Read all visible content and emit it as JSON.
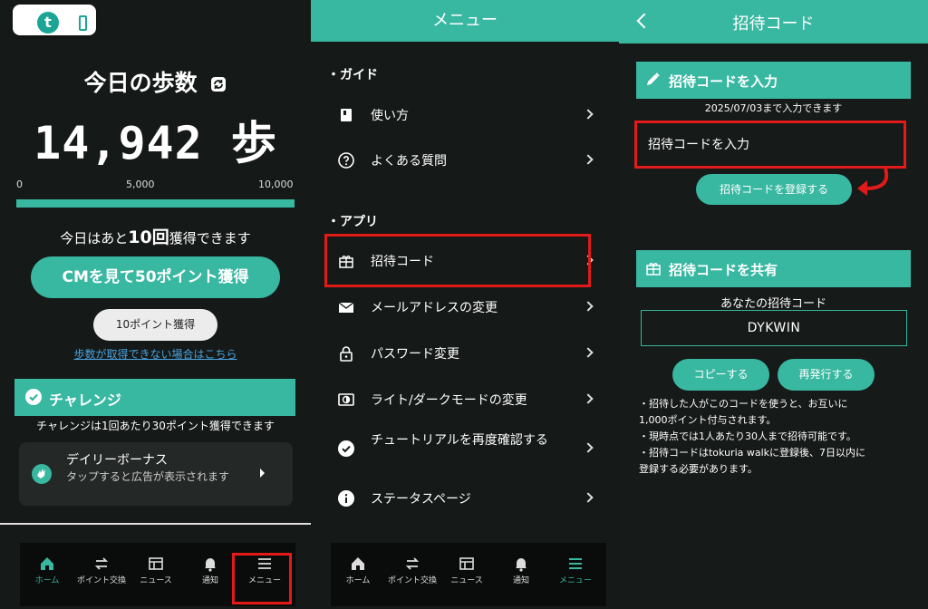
{
  "colors": {
    "accent": "#38b7a1",
    "background": "#151917",
    "highlight_red": "#e21a1a",
    "link": "#4aa3e0"
  },
  "home": {
    "logo_letter": "t",
    "title": "今日の歩数",
    "steps": "14,942 歩",
    "scale": [
      "0",
      "5,000",
      "10,000"
    ],
    "progress_fraction": 1.0,
    "remaining_prefix": "今日はあと",
    "remaining_count": "10回",
    "remaining_suffix": "獲得できます",
    "cm_button": "CMを見て50ポイント獲得",
    "points_button": "10ポイント獲得",
    "help_link": "歩数が取得できない場合はこちら",
    "challenge_title": "チャレンジ",
    "challenge_sub": "チャレンジは1回あたり30ポイント獲得できます",
    "daily_title": "デイリーボーナス",
    "daily_desc": "タップすると広告が表示されます"
  },
  "nav": {
    "items": [
      {
        "label": "ホーム",
        "icon": "home-icon"
      },
      {
        "label": "ポイント交換",
        "icon": "exchange-icon"
      },
      {
        "label": "ニュース",
        "icon": "news-icon"
      },
      {
        "label": "通知",
        "icon": "bell-icon"
      },
      {
        "label": "メニュー",
        "icon": "menu-icon"
      }
    ]
  },
  "menu": {
    "header": "メニュー",
    "guide_title": "・ガイド",
    "guide_items": [
      {
        "label": "使い方",
        "icon": "book-icon"
      },
      {
        "label": "よくある質問",
        "icon": "question-icon"
      }
    ],
    "app_title": "・アプリ",
    "app_items": [
      {
        "label": "招待コード",
        "icon": "gift-icon"
      },
      {
        "label": "メールアドレスの変更",
        "icon": "mail-icon"
      },
      {
        "label": "パスワード変更",
        "icon": "lock-icon"
      },
      {
        "label": "ライト/ダークモードの変更",
        "icon": "theme-icon"
      },
      {
        "label": "チュートリアルを再度確認する",
        "icon": "check-circle-icon"
      },
      {
        "label": "ステータスページ",
        "icon": "info-icon"
      }
    ]
  },
  "invite": {
    "header": "招待コード",
    "enter_title": "招待コードを入力",
    "deadline": "2025/07/03まで入力できます",
    "input_placeholder": "招待コードを入力",
    "register_button": "招待コードを登録する",
    "share_title": "招待コードを共有",
    "your_code_label": "あなたの招待コード",
    "code": "DYKWIN",
    "copy_button": "コピーする",
    "reissue_button": "再発行する",
    "notes": [
      "・招待した人がこのコードを使うと、お互いに",
      "1,000ポイント付与されます。",
      "・現時点では1人あたり30人まで招待可能です。",
      "・招待コードはtokuria walkに登録後、7日以内に",
      "登録する必要があります。"
    ]
  }
}
